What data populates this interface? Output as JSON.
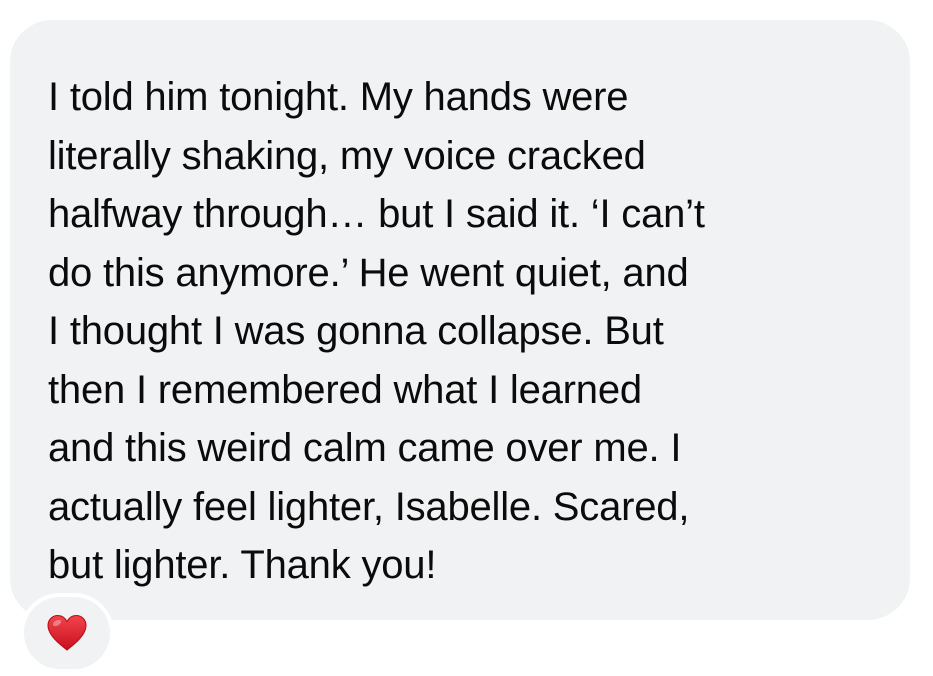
{
  "message": {
    "lines": [
      "I told him tonight. My hands were",
      "literally shaking, my voice cracked",
      "halfway through… but I said it. ‘I can’t",
      "do this anymore.’ He went quiet, and",
      "I thought I was gonna collapse. But",
      "then I remembered what I learned",
      "and this weird calm came over me. I",
      "actually feel lighter, Isabelle. Scared,",
      "but lighter. Thank you!"
    ],
    "bubble_color": "#f1f2f4",
    "text_color": "#0b0b0b"
  },
  "reaction": {
    "icon": "red-heart-icon",
    "color": "#e0202b"
  }
}
